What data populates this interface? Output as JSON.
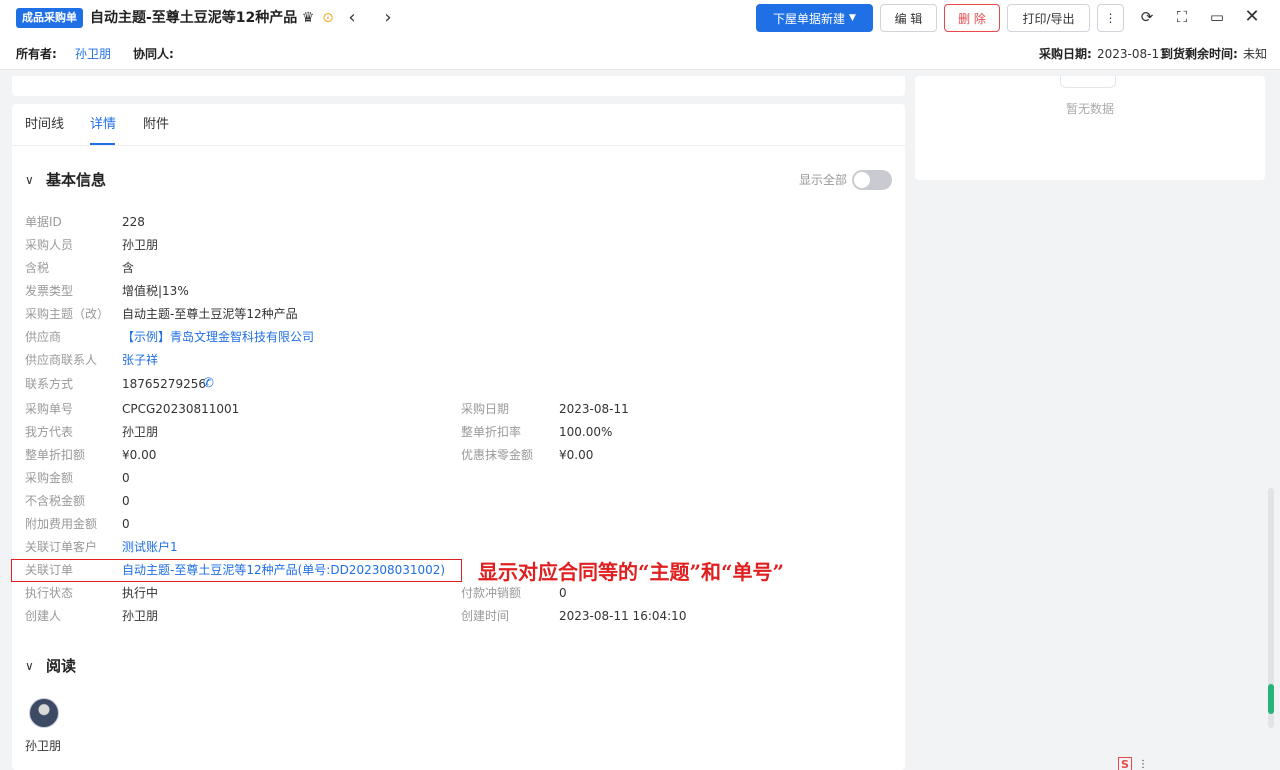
{
  "header": {
    "tag": "成品采购单",
    "title": "自动主题-至尊土豆泥等12种产品",
    "buttons": {
      "next_doc": "下屋单据新建",
      "edit": "编 辑",
      "delete": "删 除",
      "print": "打印/导出"
    }
  },
  "subheader": {
    "owner_label": "所有者:",
    "owner": "孙卫朋",
    "collab_label": "协同人:",
    "date_label": "采购日期:",
    "date": "2023-08-11",
    "remain_label": "到货剩余时间:",
    "remain": "未知"
  },
  "right_panel": {
    "empty": "暂无数据"
  },
  "tabs": [
    "时间线",
    "详情",
    "附件"
  ],
  "active_tab": "详情",
  "basic": {
    "title": "基本信息",
    "toggle_label": "显示全部",
    "rows": [
      {
        "label": "单据ID",
        "value": "228"
      },
      {
        "label": "采购人员",
        "value": "孙卫朋"
      },
      {
        "label": "含税",
        "value": "含"
      },
      {
        "label": "发票类型",
        "value": "增值税|13%"
      },
      {
        "label": "采购主题（改）",
        "value": "自动主题-至尊土豆泥等12种产品"
      },
      {
        "label": "供应商",
        "value": "【示例】青岛文理金智科技有限公司"
      },
      {
        "label": "供应商联系人",
        "value": "张子祥"
      },
      {
        "label": "联系方式",
        "value": "18765279256"
      },
      {
        "label": "采购单号",
        "value": "CPCG20230811001"
      },
      {
        "label": "我方代表",
        "value": "孙卫朋"
      },
      {
        "label": "整单折扣额",
        "value": "¥0.00"
      },
      {
        "label": "采购金额",
        "value": "0"
      },
      {
        "label": "不含税金额",
        "value": "0"
      },
      {
        "label": "附加费用金额",
        "value": "0"
      },
      {
        "label": "关联订单客户",
        "value": "测试账户1"
      },
      {
        "label": "关联订单",
        "value": "自动主题-至尊土豆泥等12种产品(单号:DD202308031002)"
      },
      {
        "label": "执行状态",
        "value": "执行中"
      },
      {
        "label": "创建人",
        "value": "孙卫朋"
      }
    ],
    "right_rows": [
      {
        "label": "采购日期",
        "value": "2023-08-11"
      },
      {
        "label": "整单折扣率",
        "value": "100.00%"
      },
      {
        "label": "优惠抹零金额",
        "value": "¥0.00"
      },
      {
        "label": "付款冲销额",
        "value": "0"
      },
      {
        "label": "创建时间",
        "value": "2023-08-11 16:04:10"
      }
    ]
  },
  "annotation": "显示对应合同等的“主题”和“单号”",
  "read": {
    "title": "阅读",
    "user": "孙卫朋"
  }
}
